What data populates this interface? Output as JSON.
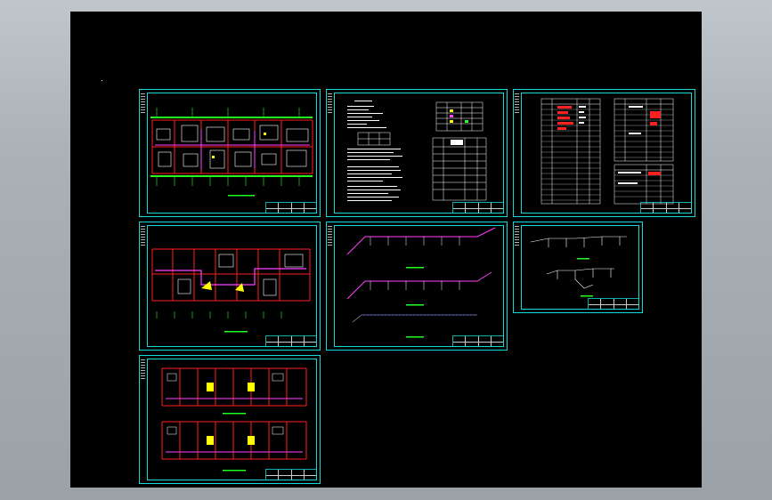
{
  "viewer": {
    "background_color": "#000000",
    "frame_color": "#14d9d9",
    "workspace_color": "#aab2b8"
  },
  "sheets": [
    {
      "id": "floor-plan-1",
      "label": ""
    },
    {
      "id": "design-notes",
      "label": ""
    },
    {
      "id": "equipment-schedule",
      "label": ""
    },
    {
      "id": "floor-plan-2",
      "label": ""
    },
    {
      "id": "isometric-1",
      "label": ""
    },
    {
      "id": "isometric-2",
      "label": ""
    },
    {
      "id": "floor-plan-3",
      "label": ""
    }
  ],
  "colors": {
    "cyan": "#14d9d9",
    "red": "#ff2020",
    "magenta": "#ff40ff",
    "white": "#ffffff",
    "yellow": "#ffff00",
    "green": "#20ff20",
    "blue": "#3040ff"
  }
}
